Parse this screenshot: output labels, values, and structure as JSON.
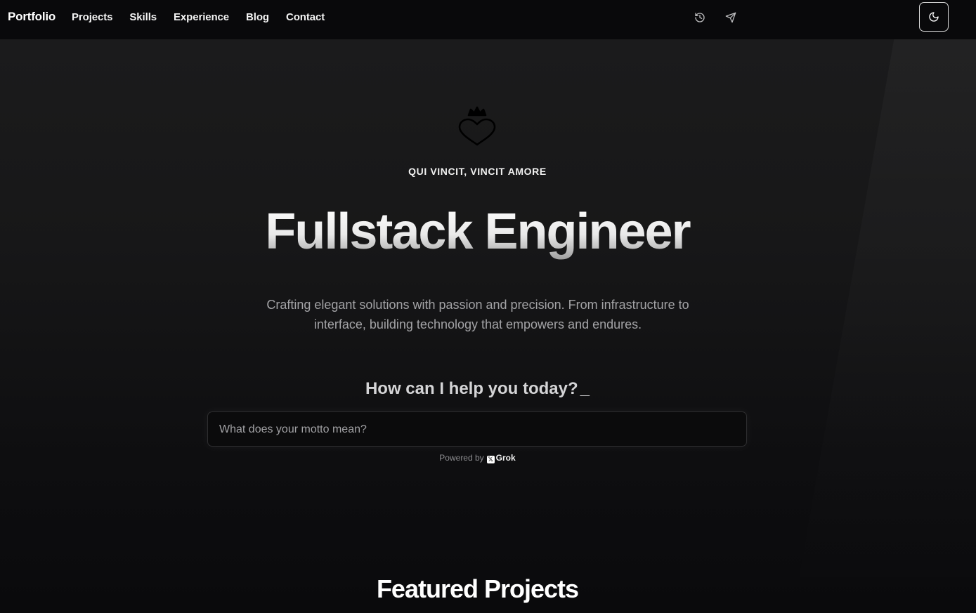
{
  "nav": {
    "brand": "Portfolio",
    "links": [
      "Projects",
      "Skills",
      "Experience",
      "Blog",
      "Contact"
    ],
    "theme_toggle_icon": "moon-icon"
  },
  "hero": {
    "emblem_icon": "crowned-heart-icon",
    "motto": "QUI VINCIT, VINCIT AMORE",
    "headline": "Fullstack Engineer",
    "lead": "Crafting elegant solutions with passion and precision. From infrastructure to interface, building technology that empowers and endures.",
    "help_prompt": "How can I help you today?",
    "help_cursor": "_"
  },
  "chat": {
    "placeholder": "What does your motto mean?",
    "value": "",
    "history_icon": "history-icon",
    "send_icon": "send-icon",
    "powered_by_label": "Powered by",
    "provider_logo": "x-logo-icon",
    "provider_name": "Grok"
  },
  "sections": {
    "featured_title": "Featured Projects"
  },
  "colors": {
    "background_top": "#1c1c1d",
    "background_bottom": "#0a0a0c",
    "nav_bg": "#09090b",
    "text_primary": "#ffffff",
    "text_muted": "#a3a3a6"
  }
}
